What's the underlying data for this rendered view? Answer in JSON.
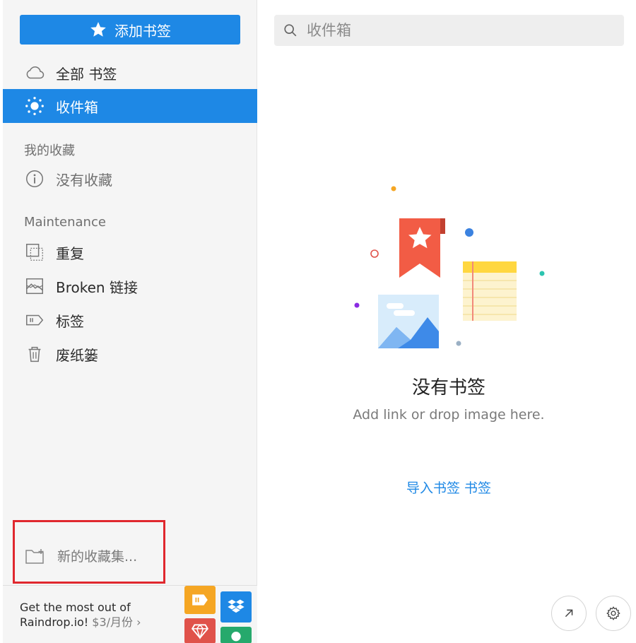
{
  "sidebar": {
    "add_button_label": "添加书签",
    "nav": {
      "all": "全部 书签",
      "inbox": "收件箱"
    },
    "favorites_header": "我的收藏",
    "no_favorites": "没有收藏",
    "maintenance_header": "Maintenance",
    "maintenance": {
      "duplicates": "重复",
      "broken": "Broken 链接",
      "tags": "标签",
      "trash": "废纸篓"
    },
    "new_collection": "新的收藏集...",
    "promo": {
      "line1": "Get the most out of",
      "line2": "Raindrop.io!",
      "price": " $3/月份",
      "chevron": "›"
    }
  },
  "main": {
    "search_placeholder": "收件箱",
    "empty_title": "没有书签",
    "empty_subtitle": "Add link or drop image here.",
    "import_link": "导入书签 书签"
  },
  "colors": {
    "accent": "#1e88e5",
    "highlight_box": "#e0282e"
  }
}
